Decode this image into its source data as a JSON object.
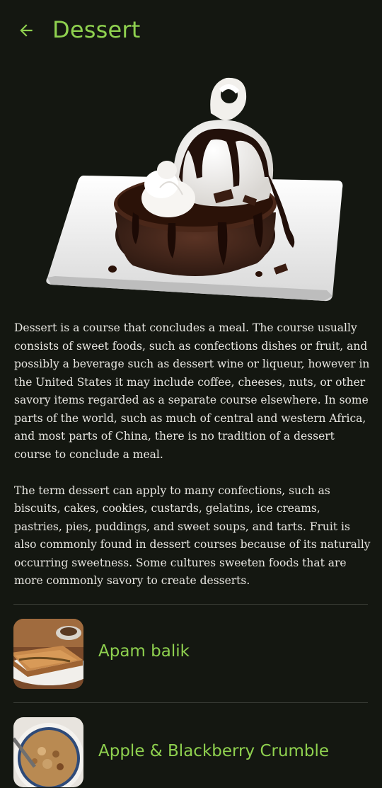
{
  "header": {
    "title": "Dessert",
    "back_icon": "arrow-left-icon",
    "accent_color": "#8fd14f"
  },
  "hero": {
    "icon": "chocolate-lava-cake-image"
  },
  "description": {
    "paragraphs": [
      "Dessert is a course that concludes a meal. The course usually consists of sweet foods, such as confections dishes or fruit, and possibly a beverage such as dessert wine or liqueur, however in the United States it may include coffee, cheeses, nuts, or other savory items regarded as a separate course elsewhere. In some parts of the world, such as much of central and western Africa, and most parts of China, there is no tradition of a dessert course to conclude a meal.",
      "The term dessert can apply to many confections, such as biscuits, cakes, cookies, custards, gelatins, ice creams, pastries, pies, puddings, and sweet soups, and tarts. Fruit is also commonly found in dessert courses because of its naturally occurring sweetness. Some cultures sweeten foods that are more commonly savory to create desserts."
    ]
  },
  "recipes": {
    "items": [
      {
        "label": "Apam balik"
      },
      {
        "label": "Apple & Blackberry Crumble"
      }
    ]
  },
  "colors": {
    "background": "#141711",
    "text": "#e9e7e2",
    "divider": "#3a3d36"
  }
}
